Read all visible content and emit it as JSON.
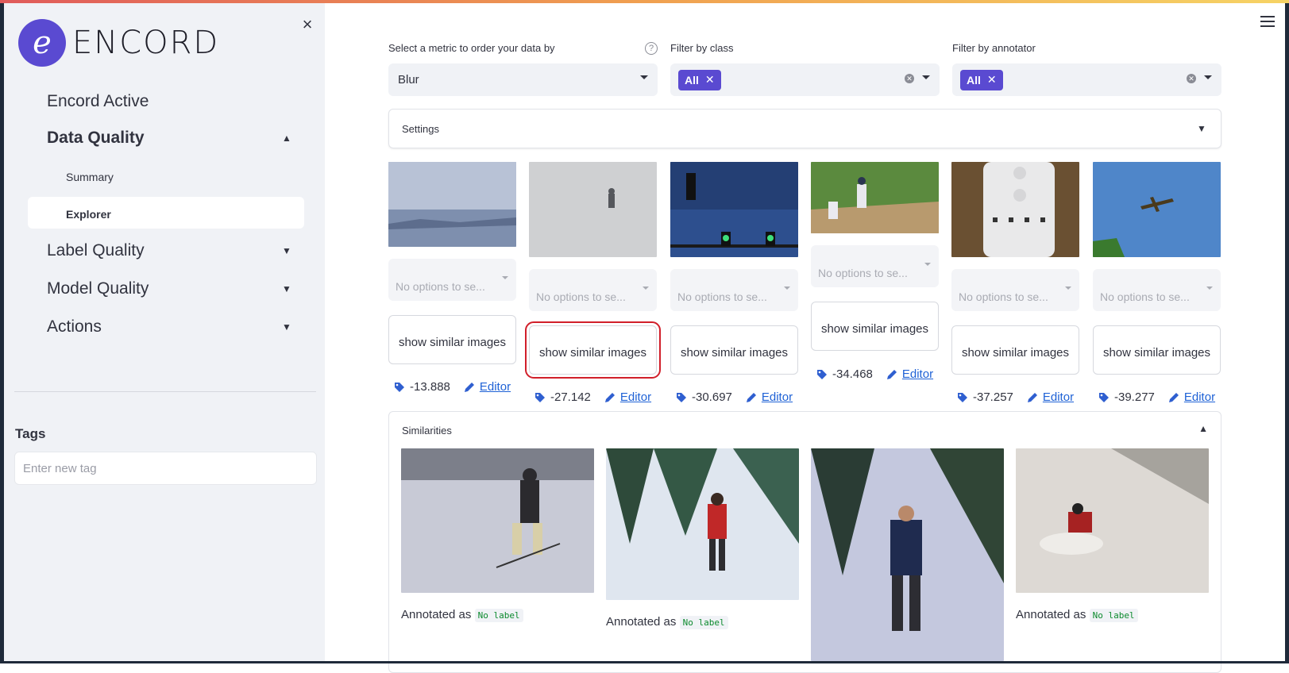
{
  "sidebar": {
    "logo_letter": "e",
    "logo_text": "ENCORD",
    "nav": [
      {
        "label": "Encord Active"
      },
      {
        "label": "Data Quality"
      },
      {
        "label": "Label Quality"
      },
      {
        "label": "Model Quality"
      },
      {
        "label": "Actions"
      }
    ],
    "sub_items": [
      {
        "label": "Summary"
      },
      {
        "label": "Explorer"
      }
    ],
    "tags_title": "Tags",
    "tag_placeholder": "Enter new tag"
  },
  "filters": {
    "metric_label": "Select a metric to order your data by",
    "metric_value": "Blur",
    "class_label": "Filter by class",
    "class_chip": "All",
    "annotator_label": "Filter by annotator",
    "annotator_chip": "All"
  },
  "settings_label": "Settings",
  "cards": [
    {
      "placeholder": "No options to se...",
      "button": "show similar images",
      "score": "-13.888",
      "editor": "Editor"
    },
    {
      "placeholder": "No options to se...",
      "button": "show similar images",
      "score": "-27.142",
      "editor": "Editor"
    },
    {
      "placeholder": "No options to se...",
      "button": "show similar images",
      "score": "-30.697",
      "editor": "Editor"
    },
    {
      "placeholder": "No options to se...",
      "button": "show similar images",
      "score": "-34.468",
      "editor": "Editor"
    },
    {
      "placeholder": "No options to se...",
      "button": "show similar images",
      "score": "-37.257",
      "editor": "Editor"
    },
    {
      "placeholder": "No options to se...",
      "button": "show similar images",
      "score": "-39.277",
      "editor": "Editor"
    }
  ],
  "similarities": {
    "title": "Similarities",
    "items": [
      {
        "annotated_prefix": "Annotated as",
        "label": "No label"
      },
      {
        "annotated_prefix": "Annotated as",
        "label": "No label"
      },
      {
        "annotated_prefix": "Annotated as",
        "label": "No label"
      }
    ]
  },
  "colors": {
    "accent": "#5a4ad1",
    "link": "#1f62d6",
    "highlight": "#d11f2a"
  }
}
